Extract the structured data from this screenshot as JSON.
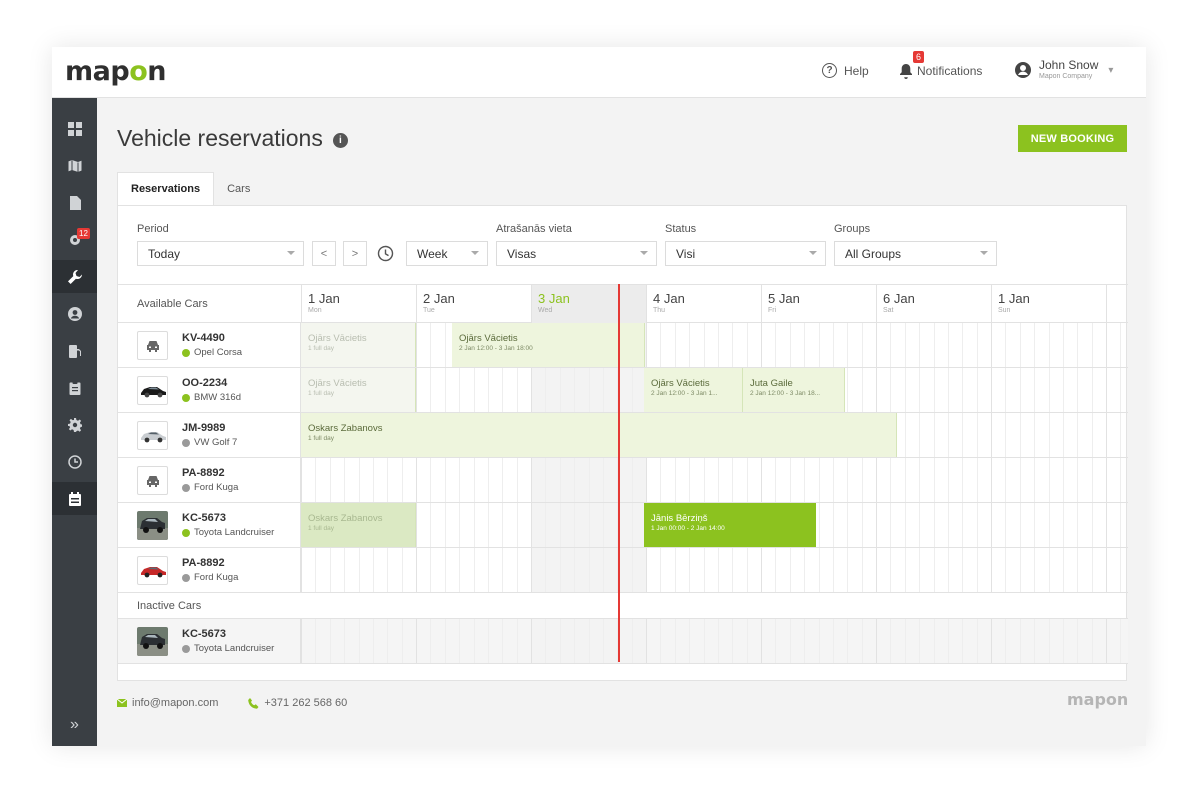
{
  "header": {
    "logo": "mapon",
    "help_label": "Help",
    "notifications_label": "Notifications",
    "notifications_count": "6",
    "user_name": "John Snow",
    "user_company": "Mapon Company"
  },
  "sidebar": {
    "items": [
      {
        "icon": "dashboard-icon"
      },
      {
        "icon": "map-icon"
      },
      {
        "icon": "document-icon"
      },
      {
        "icon": "settings-alert-icon",
        "badge": "12"
      },
      {
        "icon": "wrench-icon"
      },
      {
        "icon": "user-icon"
      },
      {
        "icon": "fuel-icon"
      },
      {
        "icon": "clipboard-icon"
      },
      {
        "icon": "gear-icon"
      },
      {
        "icon": "timer-icon"
      },
      {
        "icon": "calendar-icon"
      }
    ]
  },
  "page": {
    "title": "Vehicle reservations",
    "new_booking_label": "NEW BOOKING",
    "tabs": [
      "Reservations",
      "Cars"
    ]
  },
  "filters": {
    "period_label": "Period",
    "period_value": "Today",
    "view_value": "Week",
    "location_label": "Atrašanās vieta",
    "location_value": "Visas",
    "status_label": "Status",
    "status_value": "Visi",
    "groups_label": "Groups",
    "groups_value": "All Groups"
  },
  "calendar": {
    "available_label": "Available Cars",
    "inactive_label": "Inactive Cars",
    "days": [
      {
        "date": "1 Jan",
        "weekday": "Mon"
      },
      {
        "date": "2 Jan",
        "weekday": "Tue"
      },
      {
        "date": "3 Jan",
        "weekday": "Wed"
      },
      {
        "date": "4 Jan",
        "weekday": "Thu"
      },
      {
        "date": "5 Jan",
        "weekday": "Fri"
      },
      {
        "date": "6 Jan",
        "weekday": "Sat"
      },
      {
        "date": "1 Jan",
        "weekday": "Sun"
      }
    ],
    "cars": [
      {
        "plate": "KV-4490",
        "model": "Opel Corsa",
        "active": true
      },
      {
        "plate": "OO-2234",
        "model": "BMW 316d",
        "active": true
      },
      {
        "plate": "JM-9989",
        "model": "VW Golf 7",
        "active": false
      },
      {
        "plate": "PA-8892",
        "model": "Ford Kuga",
        "active": false
      },
      {
        "plate": "KC-5673",
        "model": "Toyota Landcruiser",
        "active": true
      },
      {
        "plate": "PA-8892",
        "model": "Ford Kuga",
        "active": false
      }
    ],
    "inactive_cars": [
      {
        "plate": "KC-5673",
        "model": "Toyota Landcruiser",
        "active": false
      }
    ],
    "bookings": [
      {
        "name": "Ojārs Vācietis",
        "time": "1 full day"
      },
      {
        "name": "Ojārs Vācietis",
        "time": "2 Jan 12:00 - 3 Jan 18:00"
      },
      {
        "name": "Ojārs Vācietis",
        "time": "1 full day"
      },
      {
        "name": "Ojārs Vācietis",
        "time": "2 Jan 12:00 - 3 Jan 1..."
      },
      {
        "name": "Juta Gaile",
        "time": "2 Jan 12:00 - 3 Jan 18..."
      },
      {
        "name": "Oskars Zabanovs",
        "time": "1 full day"
      },
      {
        "name": "Oskars Zabanovs",
        "time": "1 full day"
      },
      {
        "name": "Jānis Bērziņš",
        "time": "1 Jan 00:00 - 2 Jan 14:00"
      }
    ]
  },
  "footer": {
    "email": "info@mapon.com",
    "phone": "+371 262 568 60",
    "logo": "mapon"
  }
}
